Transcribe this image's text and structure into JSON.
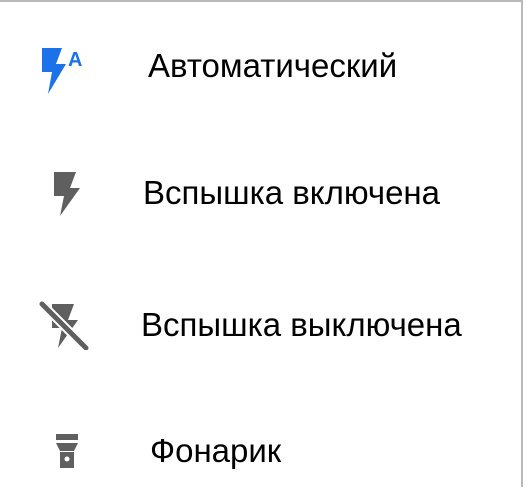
{
  "flash_menu": {
    "items": [
      {
        "icon": "flash-auto-icon",
        "label": "Автоматический",
        "icon_color": "#1a73e8"
      },
      {
        "icon": "flash-on-icon",
        "label": "Вспышка включена",
        "icon_color": "#5f5f5f"
      },
      {
        "icon": "flash-off-icon",
        "label": "Вспышка выключена",
        "icon_color": "#5f5f5f"
      },
      {
        "icon": "flashlight-icon",
        "label": "Фонарик",
        "icon_color": "#5f5f5f"
      }
    ]
  },
  "icon_glyphs": {
    "auto_badge": "A"
  },
  "colors": {
    "accent": "#1a73e8",
    "icon_gray": "#5f5f5f",
    "text": "#000000",
    "border": "#b9b9b9",
    "background": "#ffffff"
  }
}
